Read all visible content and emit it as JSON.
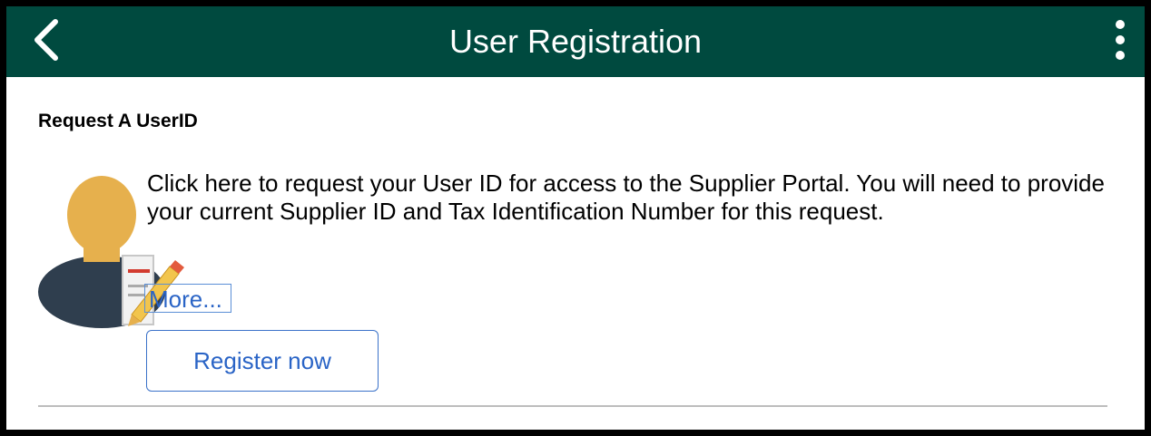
{
  "header": {
    "title": "User Registration",
    "back_icon": "chevron-left-icon",
    "menu_icon": "kebab-menu-icon",
    "background_color": "#004a3f"
  },
  "section": {
    "title": "Request A UserID",
    "description": "Click here to request your User ID for access to the Supplier Portal. You will need to provide your current Supplier ID and Tax Identification Number for this request.",
    "more_link": "More...",
    "register_button": "Register now",
    "icon": "user-registration-icon"
  }
}
